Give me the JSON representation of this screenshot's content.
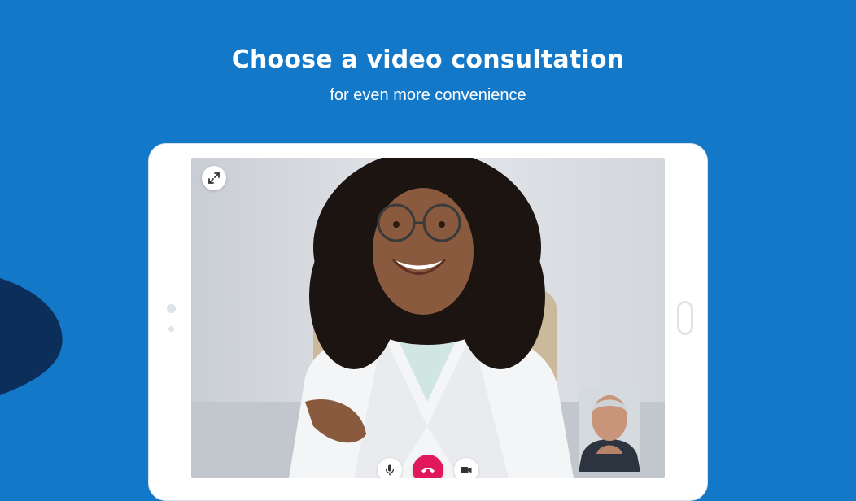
{
  "header": {
    "title": "Choose a video consultation",
    "subtitle": "for even more convenience"
  },
  "call": {
    "expand_icon": "expand-icon",
    "controls": {
      "mic_icon": "microphone-icon",
      "end_icon": "phone-hangup-icon",
      "camera_icon": "video-camera-icon"
    }
  },
  "colors": {
    "background": "#1478c8",
    "blob": "#0b2f5a",
    "end_call": "#e1185b",
    "tablet": "#ffffff"
  }
}
